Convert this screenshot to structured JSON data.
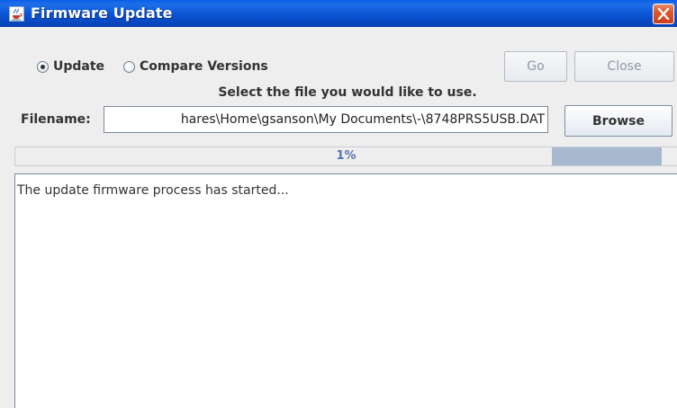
{
  "window": {
    "title": "Firmware Update",
    "icon": "java-cup-icon",
    "close_icon": "close-x-icon"
  },
  "mode": {
    "options": [
      {
        "label": "Update",
        "selected": true
      },
      {
        "label": "Compare Versions",
        "selected": false
      }
    ]
  },
  "actions": {
    "go_label": "Go",
    "go_enabled": false,
    "close_label": "Close",
    "close_enabled": false
  },
  "instruction": "Select the file you would like to use.",
  "file": {
    "label": "Filename:",
    "value": "hares\\Home\\gsanson\\My Documents\\-\\8748PRS5USB.DAT",
    "browse_label": "Browse"
  },
  "progress": {
    "percent_text": "1%",
    "value": 1,
    "fill_color": "#a8b8cf",
    "text_color": "#5674b3"
  },
  "log": {
    "text": "The update firmware process has started..."
  },
  "colors": {
    "titlebar": "#0b56d6",
    "close_button": "#e0552d",
    "dialog_background": "#eeeeee"
  }
}
